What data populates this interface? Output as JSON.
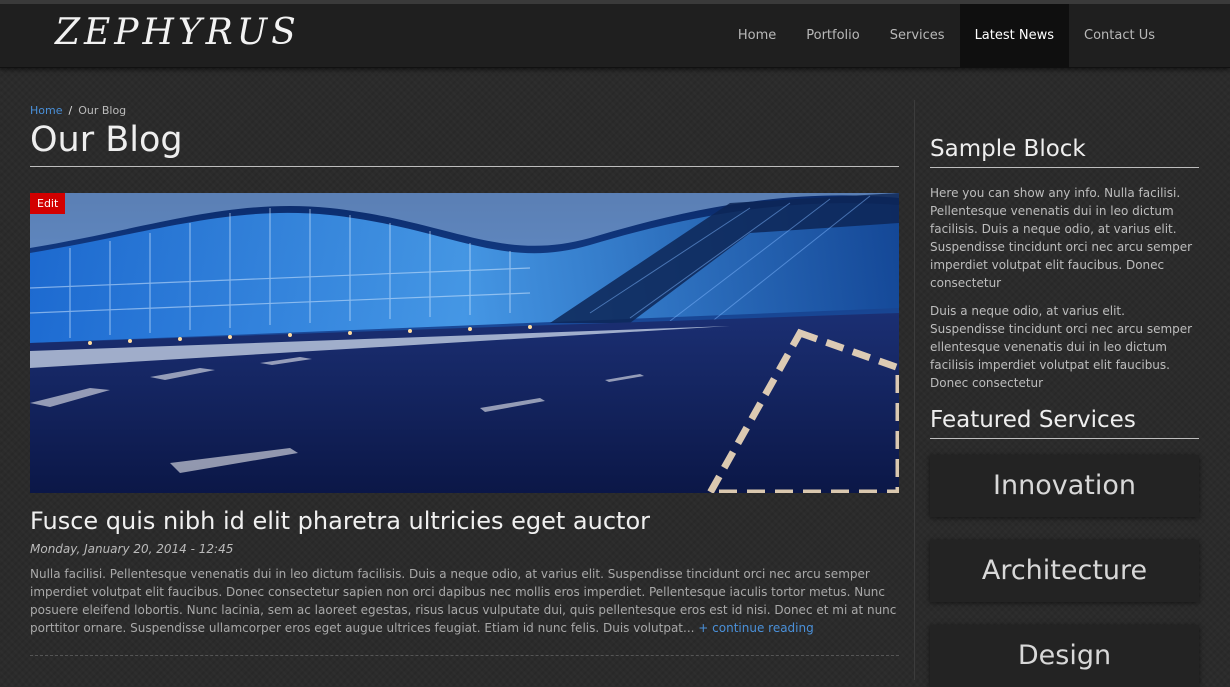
{
  "site": {
    "logo": "ZEPHYRUS"
  },
  "nav": {
    "items": [
      {
        "label": "Home"
      },
      {
        "label": "Portfolio"
      },
      {
        "label": "Services"
      },
      {
        "label": "Latest News"
      },
      {
        "label": "Contact Us"
      }
    ],
    "active": "Latest News"
  },
  "breadcrumb": {
    "home": "Home",
    "separator": "/",
    "current": "Our Blog"
  },
  "page": {
    "title": "Our Blog"
  },
  "post": {
    "edit_label": "Edit",
    "title": "Fusce quis nibh id elit pharetra ultricies eget auctor",
    "date": "Monday, January 20, 2014 - 12:45",
    "body": "Nulla facilisi. Pellentesque venenatis dui in leo dictum facilisis. Duis a neque odio, at varius elit. Suspendisse tincidunt orci nec arcu semper imperdiet volutpat elit faucibus. Donec consectetur sapien non orci dapibus nec mollis eros imperdiet. Pellentesque iaculis tortor metus. Nunc posuere eleifend lobortis. Nunc lacinia, sem ac laoreet egestas, risus lacus vulputate dui, quis pellentesque eros est id nisi. Donec et mi at nunc porttitor ornare. Suspendisse ullamcorper eros eget augue ultrices feugiat. Etiam id nunc felis. Duis volutpat...",
    "read_more": "+ continue reading"
  },
  "sidebar": {
    "sample_block": {
      "title": "Sample Block",
      "p1": "Here you can show any info. Nulla facilisi. Pellentesque venenatis dui in leo dictum facilisis. Duis a neque odio, at varius elit. Suspendisse tincidunt orci nec arcu semper imperdiet volutpat elit faucibus. Donec consectetur",
      "p2": "Duis a neque odio, at varius elit. Suspendisse tincidunt orci nec arcu semper ellentesque venenatis dui in leo dictum facilisis imperdiet volutpat elit faucibus. Donec consectetur"
    },
    "featured_services": {
      "title": "Featured Services",
      "items": [
        {
          "label": "Innovation"
        },
        {
          "label": "Architecture"
        },
        {
          "label": "Design"
        }
      ]
    }
  },
  "colors": {
    "accent": "#4a90d9",
    "edit": "#d20000",
    "nav_active_bg": "#0f0f0f"
  }
}
